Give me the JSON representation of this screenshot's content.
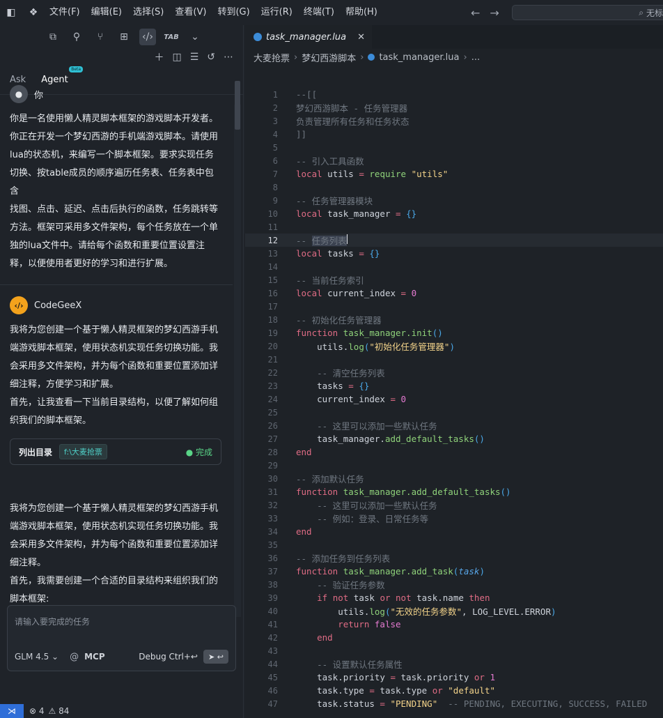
{
  "menu": [
    "文件(F)",
    "编辑(E)",
    "选择(S)",
    "查看(V)",
    "转到(G)",
    "运行(R)",
    "终端(T)",
    "帮助(H)"
  ],
  "search": {
    "text": "无标"
  },
  "left_tabs": {
    "ask": "Ask",
    "agent": "Agent",
    "beta": "Beta"
  },
  "user_msg": {
    "name": "你",
    "lines": [
      "你是一名使用懒人精灵脚本框架的游戏脚本开发者。",
      "你正在开发一个梦幻西游的手机端游戏脚本。请使用",
      "lua的状态机，来编写一个脚本框架。要求实现任务",
      "切换、按table成员的顺序遍历任务表、任务表中包含",
      "找图、点击、延迟、点击后执行的函数，任务跳转等",
      "方法。框架可采用多文件架构，每个任务放在一个单",
      "独的lua文件中。请给每个函数和重要位置设置注",
      "释，以便使用者更好的学习和进行扩展。"
    ]
  },
  "ai_msg": {
    "name": "CodeGeeX",
    "lines1": [
      "我将为您创建一个基于懒人精灵框架的梦幻西游手机",
      "端游戏脚本框架，使用状态机实现任务切换功能。我",
      "会采用多文件架构，并为每个函数和重要位置添加详",
      "细注释，方便学习和扩展。",
      "首先，让我查看一下当前目录结构，以便了解如何组",
      "织我们的脚本框架。"
    ],
    "tool_label": "列出目录",
    "tool_chip": "f:\\大麦抢票",
    "tool_status": "● 完成",
    "lines2": [
      "我将为您创建一个基于懒人精灵框架的梦幻西游手机",
      "端游戏脚本框架，使用状态机实现任务切换功能。我",
      "会采用多文件架构，并为每个函数和重要位置添加详",
      "细注释。",
      "首先，我需要创建一个合适的目录结构来组织我们的",
      "脚本框架:"
    ]
  },
  "input": {
    "placeholder": "请输入要完成的任务",
    "model": "GLM 4.5 ⌄",
    "at": "@",
    "mcp": "MCP",
    "debug": "Debug Ctrl+↩"
  },
  "status": {
    "errors": "⊗ 4",
    "warnings": "⚠ 84"
  },
  "editor": {
    "tab": "task_manager.lua",
    "breadcrumb": [
      "大麦抢票",
      "梦幻西游脚本",
      "task_manager.lua",
      "..."
    ]
  }
}
